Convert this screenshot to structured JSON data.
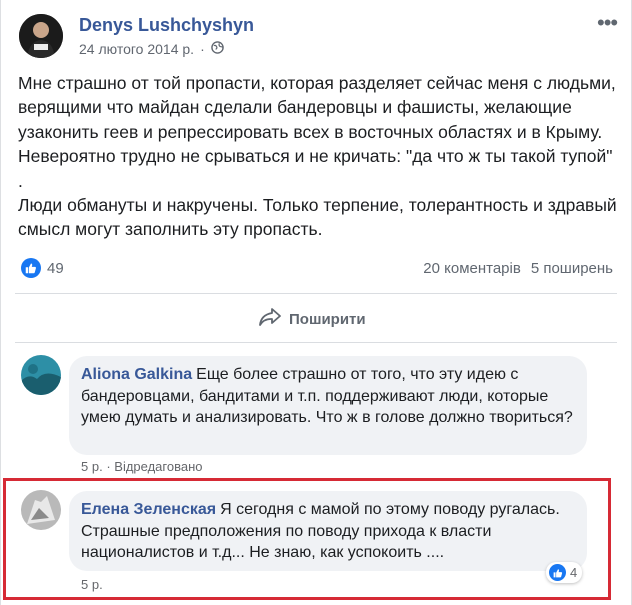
{
  "post": {
    "author": "Denys Lushchyshyn",
    "date": "24 лютого 2014 р.",
    "separator": "·",
    "text_paragraph_1": "Мне страшно от той пропасти, которая разделяет сейчас меня с людьми, верящими что майдан сделали бандеровцы и фашисты, желающие узаконить геев и репрессировать всех в восточных областях и в Крыму. Невероятно трудно не срываться и не кричать: \"да что ж ты такой тупой\" .",
    "text_paragraph_2": "Люди обмануты и накручены. Только терпение, толерантность и здравый смысл могут заполнить эту пропасть.",
    "likes": "49",
    "comments_count": "20 коментарів",
    "shares_count": "5 поширень",
    "share_label": "Поширити"
  },
  "comments": [
    {
      "author": "Aliona Galkina",
      "text": "Еще более страшно от того, что эту идею с бандеровцами, бандитами и т.п. поддерживают люди, которые умею думать и анализировать. Что ж в голове должно твориться?",
      "time": "5 р.",
      "dot": "·",
      "edited": "Відредаговано"
    },
    {
      "author": "Елена Зеленская",
      "text": "Я сегодня с мамой по этому поводу ругалась. Страшные предположения по поводу прихода к власти националистов и т.д... Не знаю, как успокоить ....",
      "time": "5 р.",
      "reactions": "4"
    }
  ],
  "colors": {
    "link": "#385898",
    "like_blue": "#1877f2",
    "highlight_red": "#d62a35",
    "bubble_bg": "#f0f2f5"
  }
}
